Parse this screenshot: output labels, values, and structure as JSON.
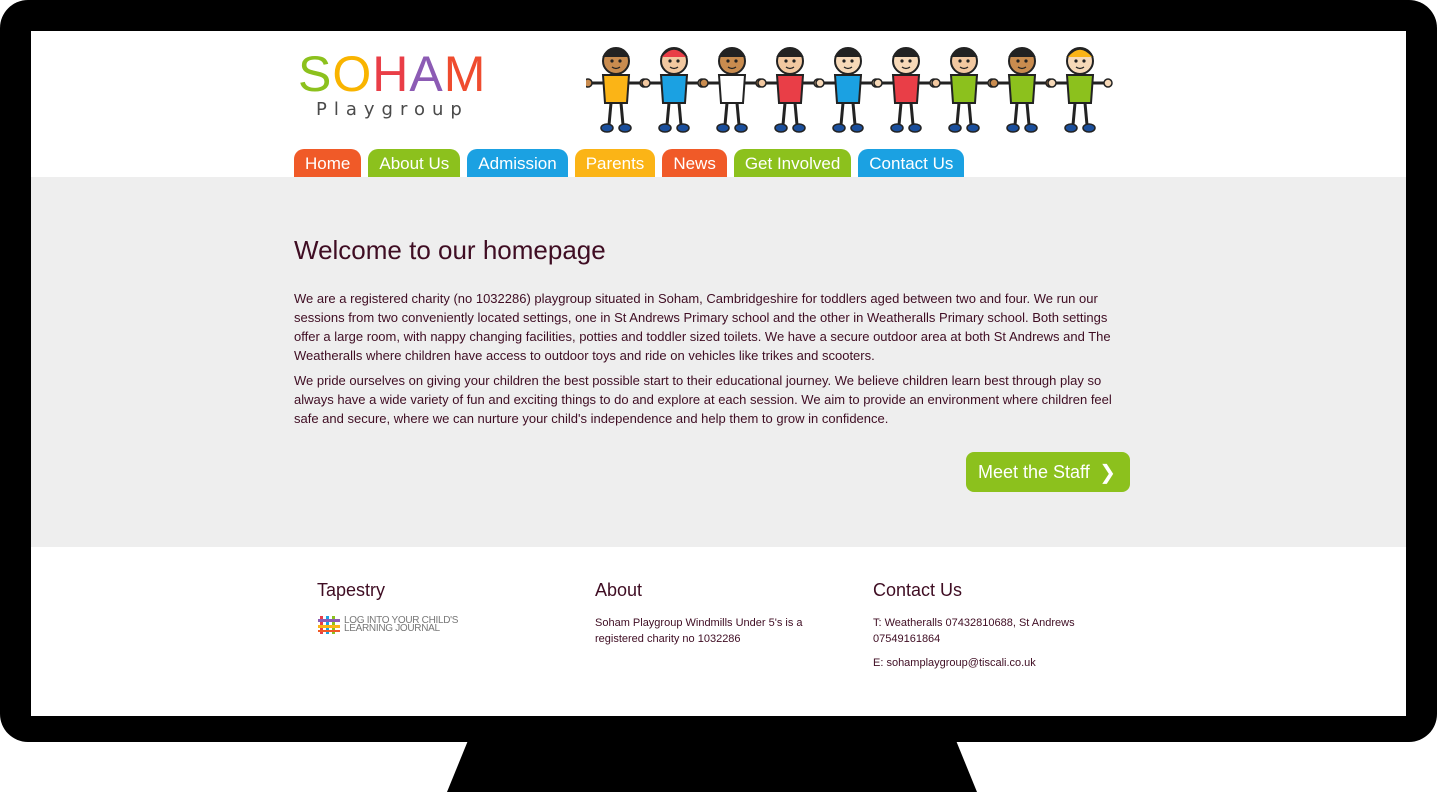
{
  "logo": {
    "word_letters": [
      "S",
      "O",
      "H",
      "A",
      "M"
    ],
    "word_colors": [
      "#8cc11d",
      "#f9b400",
      "#e93e47",
      "#8c5bb4",
      "#ef4c2f"
    ],
    "sub": "Playgroup",
    "alt_icon": "children-illustration"
  },
  "nav": {
    "tabs": [
      {
        "label": "Home",
        "color": "#f05a28"
      },
      {
        "label": "About Us",
        "color": "#8cc11d"
      },
      {
        "label": "Admission",
        "color": "#1ba1e2"
      },
      {
        "label": "Parents",
        "color": "#fbb416"
      },
      {
        "label": "News",
        "color": "#f05a28"
      },
      {
        "label": "Get Involved",
        "color": "#8cc11d"
      },
      {
        "label": "Contact Us",
        "color": "#1ba1e2"
      }
    ]
  },
  "main": {
    "title": "Welcome to our homepage",
    "paragraph1": "We are a registered charity (no 1032286) playgroup situated in Soham, Cambridgeshire for toddlers aged between two and four. We run our sessions from two conveniently located settings, one in St Andrews Primary school and the other in Weatheralls Primary school. Both settings offer a large room, with nappy changing facilities, potties and toddler sized toilets. We have a secure outdoor area at both St Andrews and The Weatheralls where children have access to outdoor toys and ride on vehicles like trikes and scooters.",
    "paragraph2": "We pride ourselves on giving your children the best possible start to their educational journey. We believe children learn best through play so always have a wide variety of fun and exciting things to do and explore at each session. We aim to provide an environment where children feel safe and secure, where we can nurture your child's independence and help them to grow in confidence.",
    "staff_button": "Meet the Staff"
  },
  "footer": {
    "tapestry": {
      "heading": "Tapestry",
      "link_line1": "LOG INTO YOUR CHILD'S",
      "link_line2": "LEARNING JOURNAL"
    },
    "about": {
      "heading": "About",
      "text": "Soham Playgroup Windmills Under 5's is a registered charity no 1032286"
    },
    "contact": {
      "heading": "Contact Us",
      "phone": "T: Weatheralls 07432810688, St Andrews 07549161864",
      "email": "E: sohamplaygroup@tiscali.co.uk"
    }
  }
}
